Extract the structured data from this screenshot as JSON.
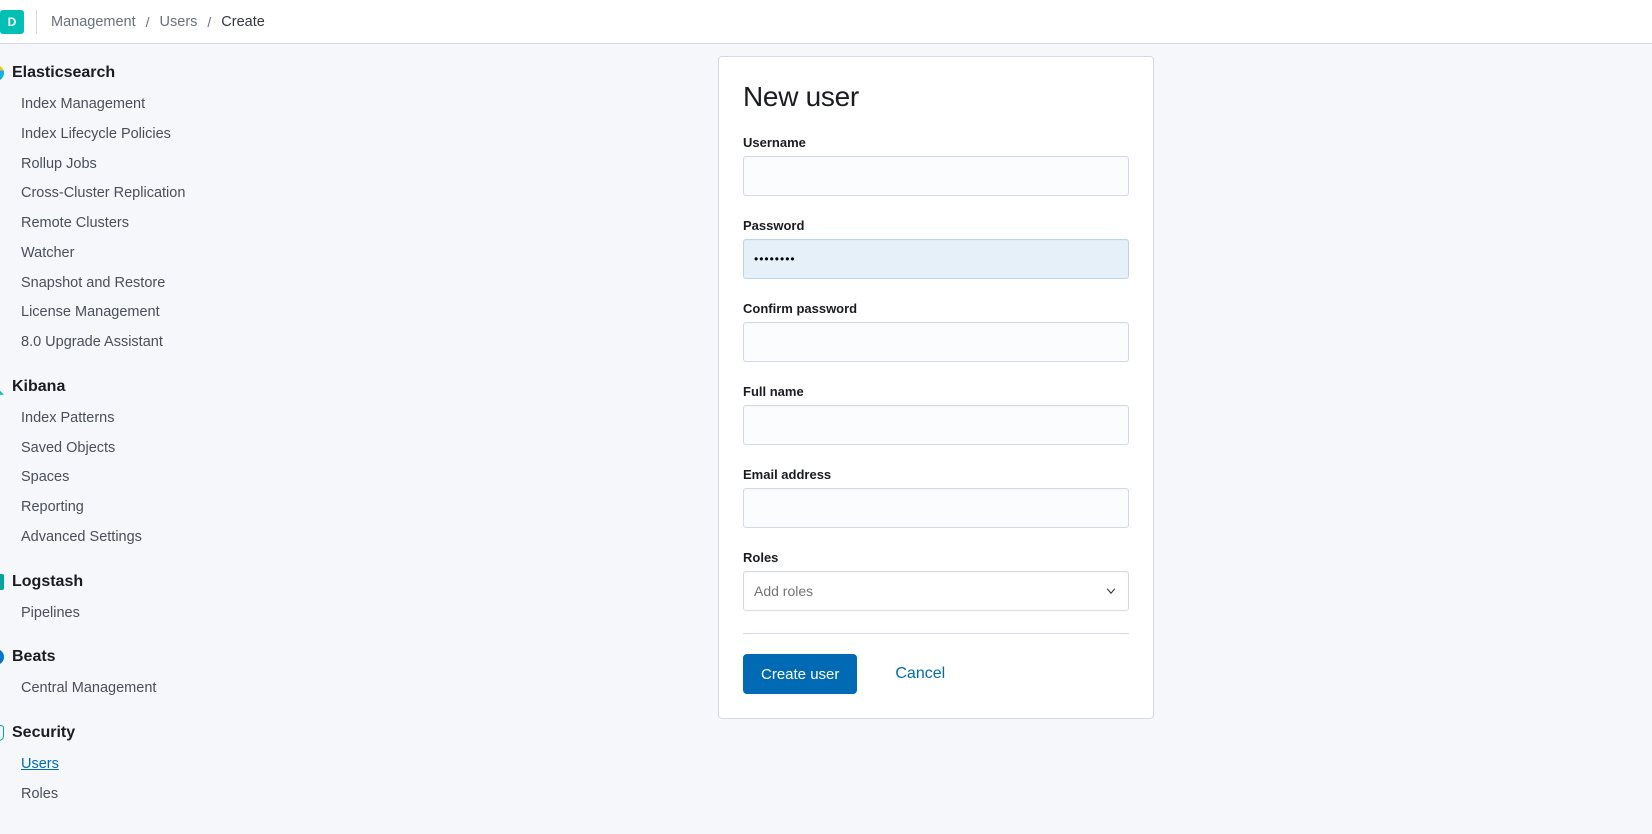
{
  "space_badge_letter": "D",
  "breadcrumbs": [
    {
      "label": "Management",
      "current": false
    },
    {
      "label": "Users",
      "current": false
    },
    {
      "label": "Create",
      "current": true
    }
  ],
  "sidebar": {
    "sections": [
      {
        "id": "elasticsearch",
        "title": "Elasticsearch",
        "icon": "ic-es",
        "items": [
          {
            "label": "Index Management"
          },
          {
            "label": "Index Lifecycle Policies"
          },
          {
            "label": "Rollup Jobs"
          },
          {
            "label": "Cross-Cluster Replication"
          },
          {
            "label": "Remote Clusters"
          },
          {
            "label": "Watcher"
          },
          {
            "label": "Snapshot and Restore"
          },
          {
            "label": "License Management"
          },
          {
            "label": "8.0 Upgrade Assistant"
          }
        ]
      },
      {
        "id": "kibana",
        "title": "Kibana",
        "icon": "ic-kb",
        "items": [
          {
            "label": "Index Patterns"
          },
          {
            "label": "Saved Objects"
          },
          {
            "label": "Spaces"
          },
          {
            "label": "Reporting"
          },
          {
            "label": "Advanced Settings"
          }
        ]
      },
      {
        "id": "logstash",
        "title": "Logstash",
        "icon": "ic-ls",
        "items": [
          {
            "label": "Pipelines"
          }
        ]
      },
      {
        "id": "beats",
        "title": "Beats",
        "icon": "ic-bt",
        "items": [
          {
            "label": "Central Management"
          }
        ]
      },
      {
        "id": "security",
        "title": "Security",
        "icon": "ic-sec",
        "items": [
          {
            "label": "Users",
            "active": true
          },
          {
            "label": "Roles"
          }
        ]
      }
    ]
  },
  "form": {
    "title": "New user",
    "fields": {
      "username": {
        "label": "Username",
        "value": ""
      },
      "password": {
        "label": "Password",
        "value": "••••••••"
      },
      "confirm_password": {
        "label": "Confirm password",
        "value": ""
      },
      "full_name": {
        "label": "Full name",
        "value": ""
      },
      "email": {
        "label": "Email address",
        "value": ""
      },
      "roles": {
        "label": "Roles",
        "placeholder": "Add roles"
      }
    },
    "actions": {
      "submit": "Create user",
      "cancel": "Cancel"
    }
  }
}
